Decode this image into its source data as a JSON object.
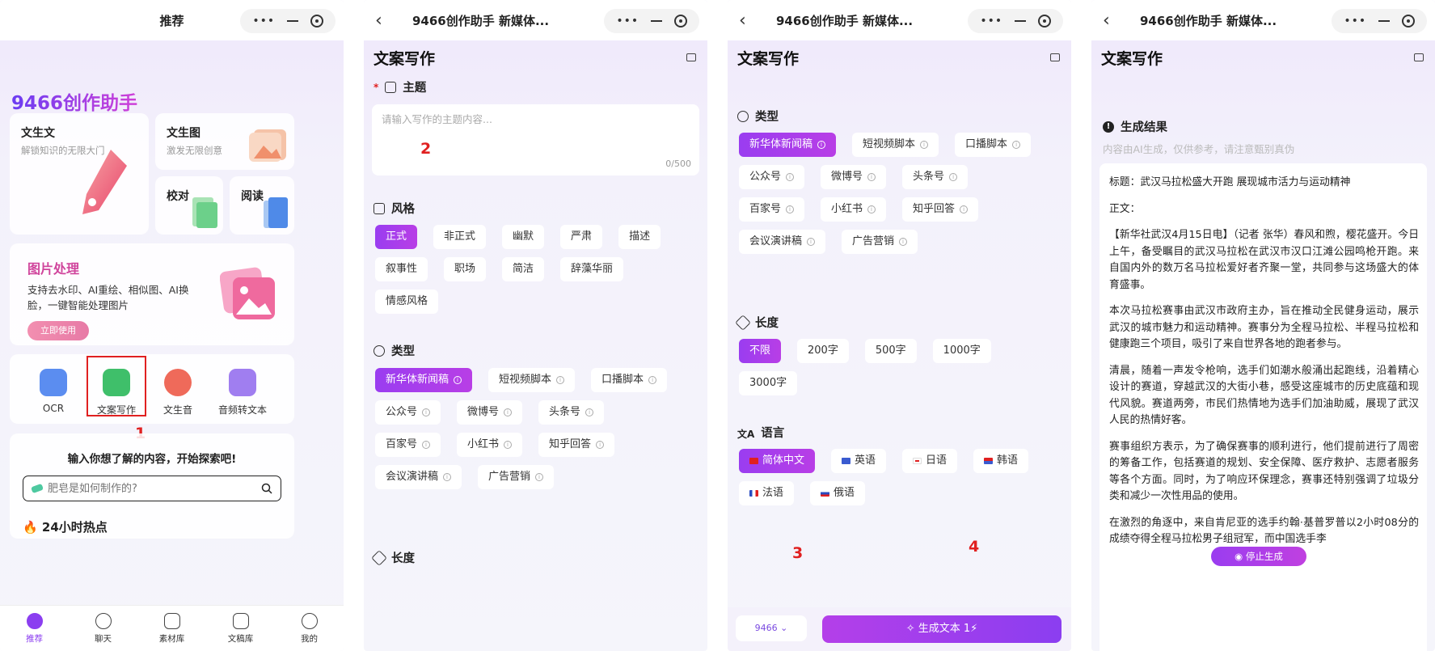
{
  "panel1": {
    "nav_title": "推荐",
    "logo": "9466创作助手",
    "cards": {
      "wenshengwen": {
        "title": "文生文",
        "sub": "解锁知识的无限大门"
      },
      "wenshengtu": {
        "title": "文生图",
        "sub": "激发无限创意"
      },
      "jiaodui": {
        "title": "校对"
      },
      "yuedu": {
        "title": "阅读"
      }
    },
    "image_processing": {
      "title": "图片处理",
      "desc": "支持去水印、AI重绘、相似图、AI换脸，一键智能处理图片",
      "button": "立即使用"
    },
    "tools": [
      {
        "label": "OCR",
        "color": "#5b8df0"
      },
      {
        "label": "文案写作",
        "color": "#3fbf6a"
      },
      {
        "label": "文生音",
        "color": "#ef6a5a"
      },
      {
        "label": "音频转文本",
        "color": "#a07ef0"
      }
    ],
    "marker": "1",
    "explore_title": "输入你想了解的内容，开始探索吧!",
    "search_placeholder": "肥皂是如何制作的?",
    "hot_title": "24小时热点",
    "tabs": [
      {
        "label": "推荐",
        "icon": "home-icon"
      },
      {
        "label": "聊天",
        "icon": "chat-icon"
      },
      {
        "label": "素材库",
        "icon": "folder-icon"
      },
      {
        "label": "文稿库",
        "icon": "document-icon"
      },
      {
        "label": "我的",
        "icon": "profile-icon"
      }
    ]
  },
  "nav_title_app": "9466创作助手 新媒体...",
  "page_title": "文案写作",
  "panel2": {
    "topic_label": "主题",
    "topic_placeholder": "请输入写作的主题内容...",
    "topic_count": "0/500",
    "marker": "2",
    "style_label": "风格",
    "styles": [
      "正式",
      "非正式",
      "幽默",
      "严肃",
      "描述",
      "叙事性",
      "职场",
      "简洁",
      "辞藻华丽",
      "情感风格"
    ],
    "type_label": "类型",
    "types": [
      "新华体新闻稿",
      "短视频脚本",
      "口播脚本",
      "公众号",
      "微博号",
      "头条号",
      "百家号",
      "小红书",
      "知乎回答",
      "会议演讲稿",
      "广告营销"
    ],
    "length_label": "长度"
  },
  "panel3": {
    "type_label": "类型",
    "types": [
      "新华体新闻稿",
      "短视频脚本",
      "口播脚本",
      "公众号",
      "微博号",
      "头条号",
      "百家号",
      "小红书",
      "知乎回答",
      "会议演讲稿",
      "广告营销"
    ],
    "length_label": "长度",
    "lengths": [
      "不限",
      "200字",
      "500字",
      "1000字",
      "3000字"
    ],
    "language_label": "语言",
    "languages": [
      {
        "label": "简体中文",
        "flag_color": "#e02020"
      },
      {
        "label": "英语",
        "flag_color": "#3a5bd0"
      },
      {
        "label": "日语",
        "flag_color": "#e02020"
      },
      {
        "label": "韩语",
        "flag_color": "#3a5bd0"
      },
      {
        "label": "法语",
        "flag_color": "#2a4cc0"
      },
      {
        "label": "俄语",
        "flag_color": "#2a4cc0"
      }
    ],
    "model": "9466",
    "model_marker": "3",
    "generate_button": "生成文本 1",
    "generate_marker": "4"
  },
  "panel4": {
    "result_title": "生成结果",
    "result_note": "内容由AI生成，仅供参考，请注意甄别真伪",
    "paragraphs": [
      "标题：武汉马拉松盛大开跑 展现城市活力与运动精神",
      "正文：",
      "【新华社武汉4月15日电】（记者 张华）春风和煦，樱花盛开。今日上午，备受瞩目的武汉马拉松在武汉市汉口江滩公园鸣枪开跑。来自国内外的数万名马拉松爱好者齐聚一堂，共同参与这场盛大的体育盛事。",
      "本次马拉松赛事由武汉市政府主办，旨在推动全民健身运动，展示武汉的城市魅力和运动精神。赛事分为全程马拉松、半程马拉松和健康跑三个项目，吸引了来自世界各地的跑者参与。",
      "清晨，随着一声发令枪响，选手们如潮水般涌出起跑线，沿着精心设计的赛道，穿越武汉的大街小巷，感受这座城市的历史底蕴和现代风貌。赛道两旁，市民们热情地为选手们加油助威，展现了武汉人民的热情好客。",
      "赛事组织方表示，为了确保赛事的顺利进行，他们提前进行了周密的筹备工作，包括赛道的规划、安全保障、医疗救护、志愿者服务等各个方面。同时，为了响应环保理念，赛事还特别强调了垃圾分类和减少一次性用品的使用。",
      "在激烈的角逐中，来自肯尼亚的选手约翰·基普罗普以2小时08分的成绩夺得全程马拉松男子组冠军，而中国选手李"
    ],
    "stop_button": "停止生成"
  },
  "colors": {
    "accent": "#9a3df0",
    "marker": "#e02020"
  }
}
